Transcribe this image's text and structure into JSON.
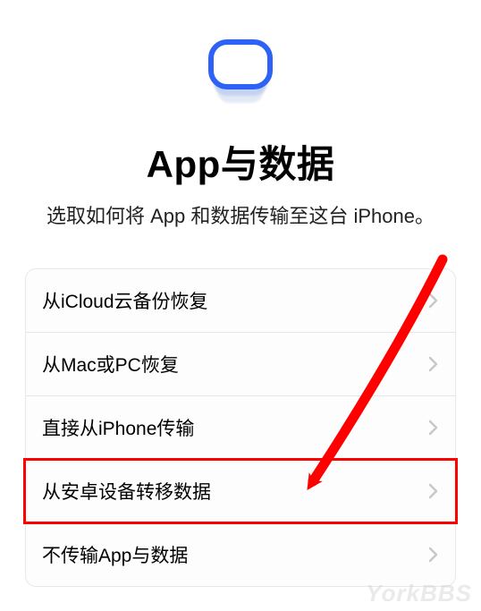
{
  "header": {
    "icon": "app-data-stack-icon",
    "title": "App与数据",
    "subtitle": "选取如何将 App 和数据传输至这台 iPhone。"
  },
  "options": [
    {
      "label": "从iCloud云备份恢复",
      "highlighted": false
    },
    {
      "label": "从Mac或PC恢复",
      "highlighted": false
    },
    {
      "label": "直接从iPhone传输",
      "highlighted": false
    },
    {
      "label": "从安卓设备转移数据",
      "highlighted": true
    },
    {
      "label": "不传输App与数据",
      "highlighted": false
    }
  ],
  "annotation": {
    "type": "red-arrow",
    "targetOptionIndex": 3
  },
  "watermark": "YorkBBS"
}
